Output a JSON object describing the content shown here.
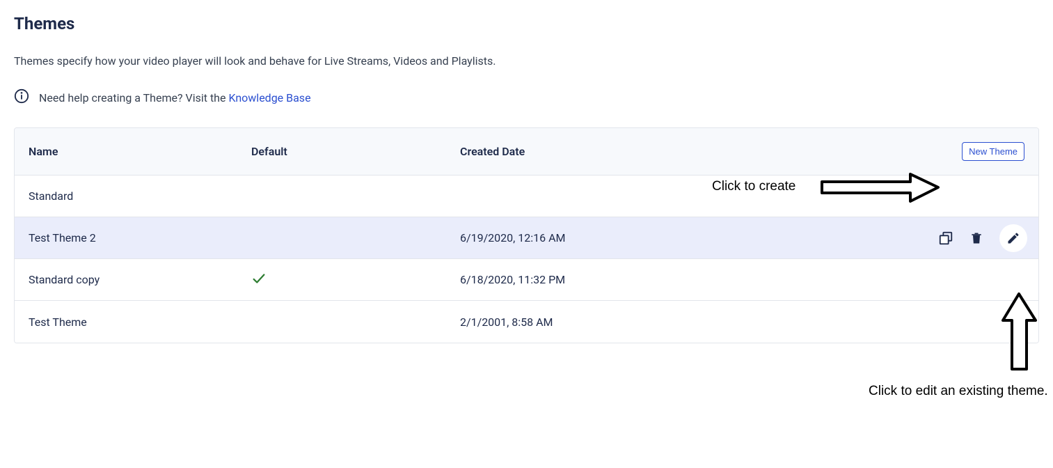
{
  "page": {
    "title": "Themes",
    "description": "Themes specify how your video player will look and behave for Live Streams, Videos and Playlists."
  },
  "help": {
    "text_prefix": "Need help creating a Theme? Visit the ",
    "link_text": "Knowledge Base"
  },
  "table": {
    "headers": {
      "name": "Name",
      "default": "Default",
      "created": "Created Date"
    },
    "new_button": "New Theme",
    "rows": [
      {
        "name": "Standard",
        "default": false,
        "created": "",
        "selected": false,
        "show_actions": false
      },
      {
        "name": "Test Theme 2",
        "default": false,
        "created": "6/19/2020, 12:16 AM",
        "selected": true,
        "show_actions": true
      },
      {
        "name": "Standard copy",
        "default": true,
        "created": "6/18/2020, 11:32 PM",
        "selected": false,
        "show_actions": false
      },
      {
        "name": "Test Theme",
        "default": false,
        "created": "2/1/2001, 8:58 AM",
        "selected": false,
        "show_actions": false
      }
    ]
  },
  "annotations": {
    "create_label": "Click to create",
    "edit_label": "Click to edit an existing theme."
  }
}
